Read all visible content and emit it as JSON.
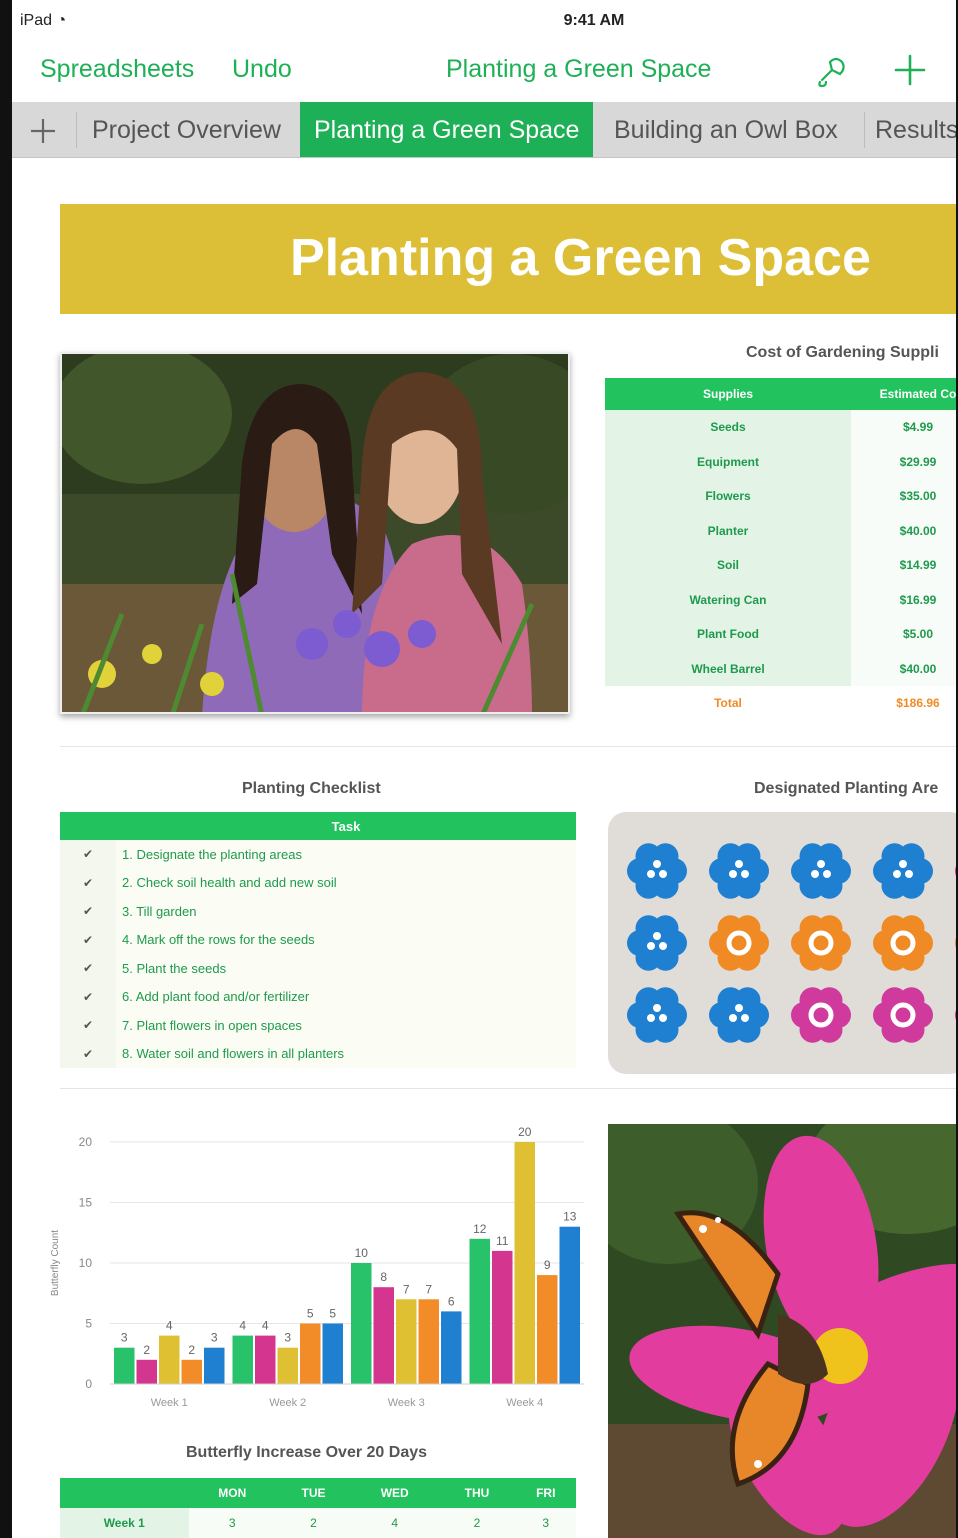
{
  "status": {
    "carrier": "iPad",
    "time": "9:41 AM"
  },
  "nav": {
    "back_label": "Spreadsheets",
    "undo_label": "Undo",
    "title": "Planting a Green Space"
  },
  "tabs": [
    "Project Overview",
    "Planting a Green Space",
    "Building an Owl Box",
    "Results"
  ],
  "colors": {
    "accent": "#1eb056",
    "banner": "#dcbf36",
    "total": "#f08a24"
  },
  "banner": {
    "title": "Planting a Green Space"
  },
  "supplies": {
    "caption": "Cost of Gardening Suppli",
    "headers": [
      "Supplies",
      "Estimated Co"
    ],
    "rows": [
      {
        "item": "Seeds",
        "cost": "$4.99"
      },
      {
        "item": "Equipment",
        "cost": "$29.99"
      },
      {
        "item": "Flowers",
        "cost": "$35.00"
      },
      {
        "item": "Planter",
        "cost": "$40.00"
      },
      {
        "item": "Soil",
        "cost": "$14.99"
      },
      {
        "item": "Watering Can",
        "cost": "$16.99"
      },
      {
        "item": "Plant Food",
        "cost": "$5.00"
      },
      {
        "item": "Wheel Barrel",
        "cost": "$40.00"
      }
    ],
    "total_label": "Total",
    "total_value": "$186.96"
  },
  "checklist": {
    "caption": "Planting Checklist",
    "header": "Task",
    "items": [
      "1. Designate the planting areas",
      "2. Check soil health and add new soil",
      "3. Till garden",
      "4. Mark off the rows for the seeds",
      "5. Plant the seeds",
      "6. Add plant food and/or fertilizer",
      "7. Plant flowers in open spaces",
      "8. Water soil and flowers in all planters"
    ],
    "check_glyph": "✔"
  },
  "planting_area": {
    "caption": "Designated Planting Are",
    "grid": [
      [
        "blue",
        "blue",
        "blue",
        "blue",
        "pink"
      ],
      [
        "blue",
        "orange",
        "orange",
        "orange",
        "orange"
      ],
      [
        "blue",
        "blue",
        "pink",
        "pink",
        "pink"
      ]
    ],
    "flower_colors": {
      "blue": "#1f7fd1",
      "orange": "#f08a24",
      "pink": "#cf3a9c"
    }
  },
  "chart_data": {
    "type": "bar",
    "categories": [
      "Week 1",
      "Week 2",
      "Week 3",
      "Week 4"
    ],
    "series": [
      {
        "color": "#27c26a",
        "values": [
          3,
          4,
          10,
          12
        ]
      },
      {
        "color": "#d3358f",
        "values": [
          2,
          4,
          8,
          11
        ]
      },
      {
        "color": "#dfc033",
        "values": [
          4,
          3,
          7,
          20
        ]
      },
      {
        "color": "#f28c28",
        "values": [
          2,
          5,
          7,
          9
        ]
      },
      {
        "color": "#1f7fd1",
        "values": [
          3,
          5,
          6,
          13
        ]
      }
    ],
    "ylabel": "Butterfly Count",
    "ylim": [
      0,
      20
    ],
    "yticks": [
      0,
      5,
      10,
      15,
      20
    ],
    "grid": true,
    "data_labels": true
  },
  "butterfly_table": {
    "caption": "Butterfly Increase Over 20 Days",
    "headers": [
      "",
      "MON",
      "TUE",
      "WED",
      "THU",
      "FRI"
    ],
    "rows": [
      {
        "label": "Week 1",
        "values": [
          "3",
          "2",
          "4",
          "2",
          "3"
        ]
      }
    ]
  }
}
